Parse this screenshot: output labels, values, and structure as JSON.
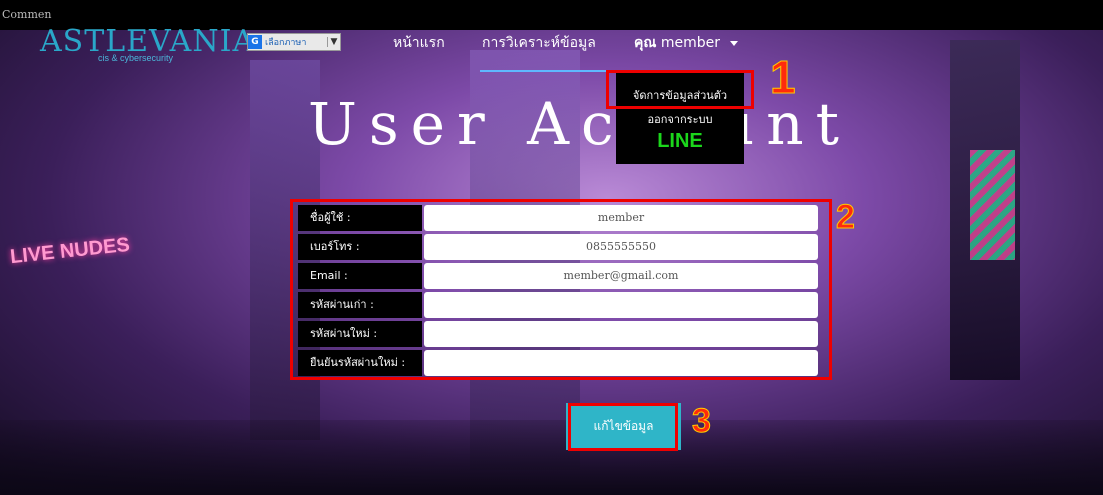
{
  "corner_text": "Commen",
  "logo": {
    "title": "ASTLEVANIA",
    "subtitle": "cis & cybersecurity"
  },
  "language": {
    "label": "เลือกภาษา",
    "icon": "google-icon",
    "dropdown_icon": "chevron-down-icon"
  },
  "nav": {
    "home": "หน้าแรก",
    "analysis": "การวิเคราะห์ข้อมูล",
    "user_prefix": "คุณ",
    "user_name": "member"
  },
  "page_title": "User Account",
  "user_menu": {
    "items": [
      "จัดการข้อมูลส่วนตัว",
      "ออกจากระบบ"
    ],
    "line_label": "LINE"
  },
  "form": {
    "rows": [
      {
        "label": "ชื่อผู้ใช้ :",
        "value": "member"
      },
      {
        "label": "เบอร์โทร :",
        "value": "0855555550"
      },
      {
        "label": "Email :",
        "value": "member@gmail.com"
      },
      {
        "label": "รหัสผ่านเก่า :",
        "value": ""
      },
      {
        "label": "รหัสผ่านใหม่ :",
        "value": ""
      },
      {
        "label": "ยืนยันรหัสผ่านใหม่ :",
        "value": ""
      }
    ],
    "submit_label": "แก้ไขข้อมูล"
  },
  "annotations": {
    "n1": "1",
    "n2": "2",
    "n3": "3"
  },
  "background_sign": "LIVE NUDES",
  "colors": {
    "accent": "#2fb5c8",
    "highlight": "#e00000",
    "line": "#1bd61b"
  }
}
